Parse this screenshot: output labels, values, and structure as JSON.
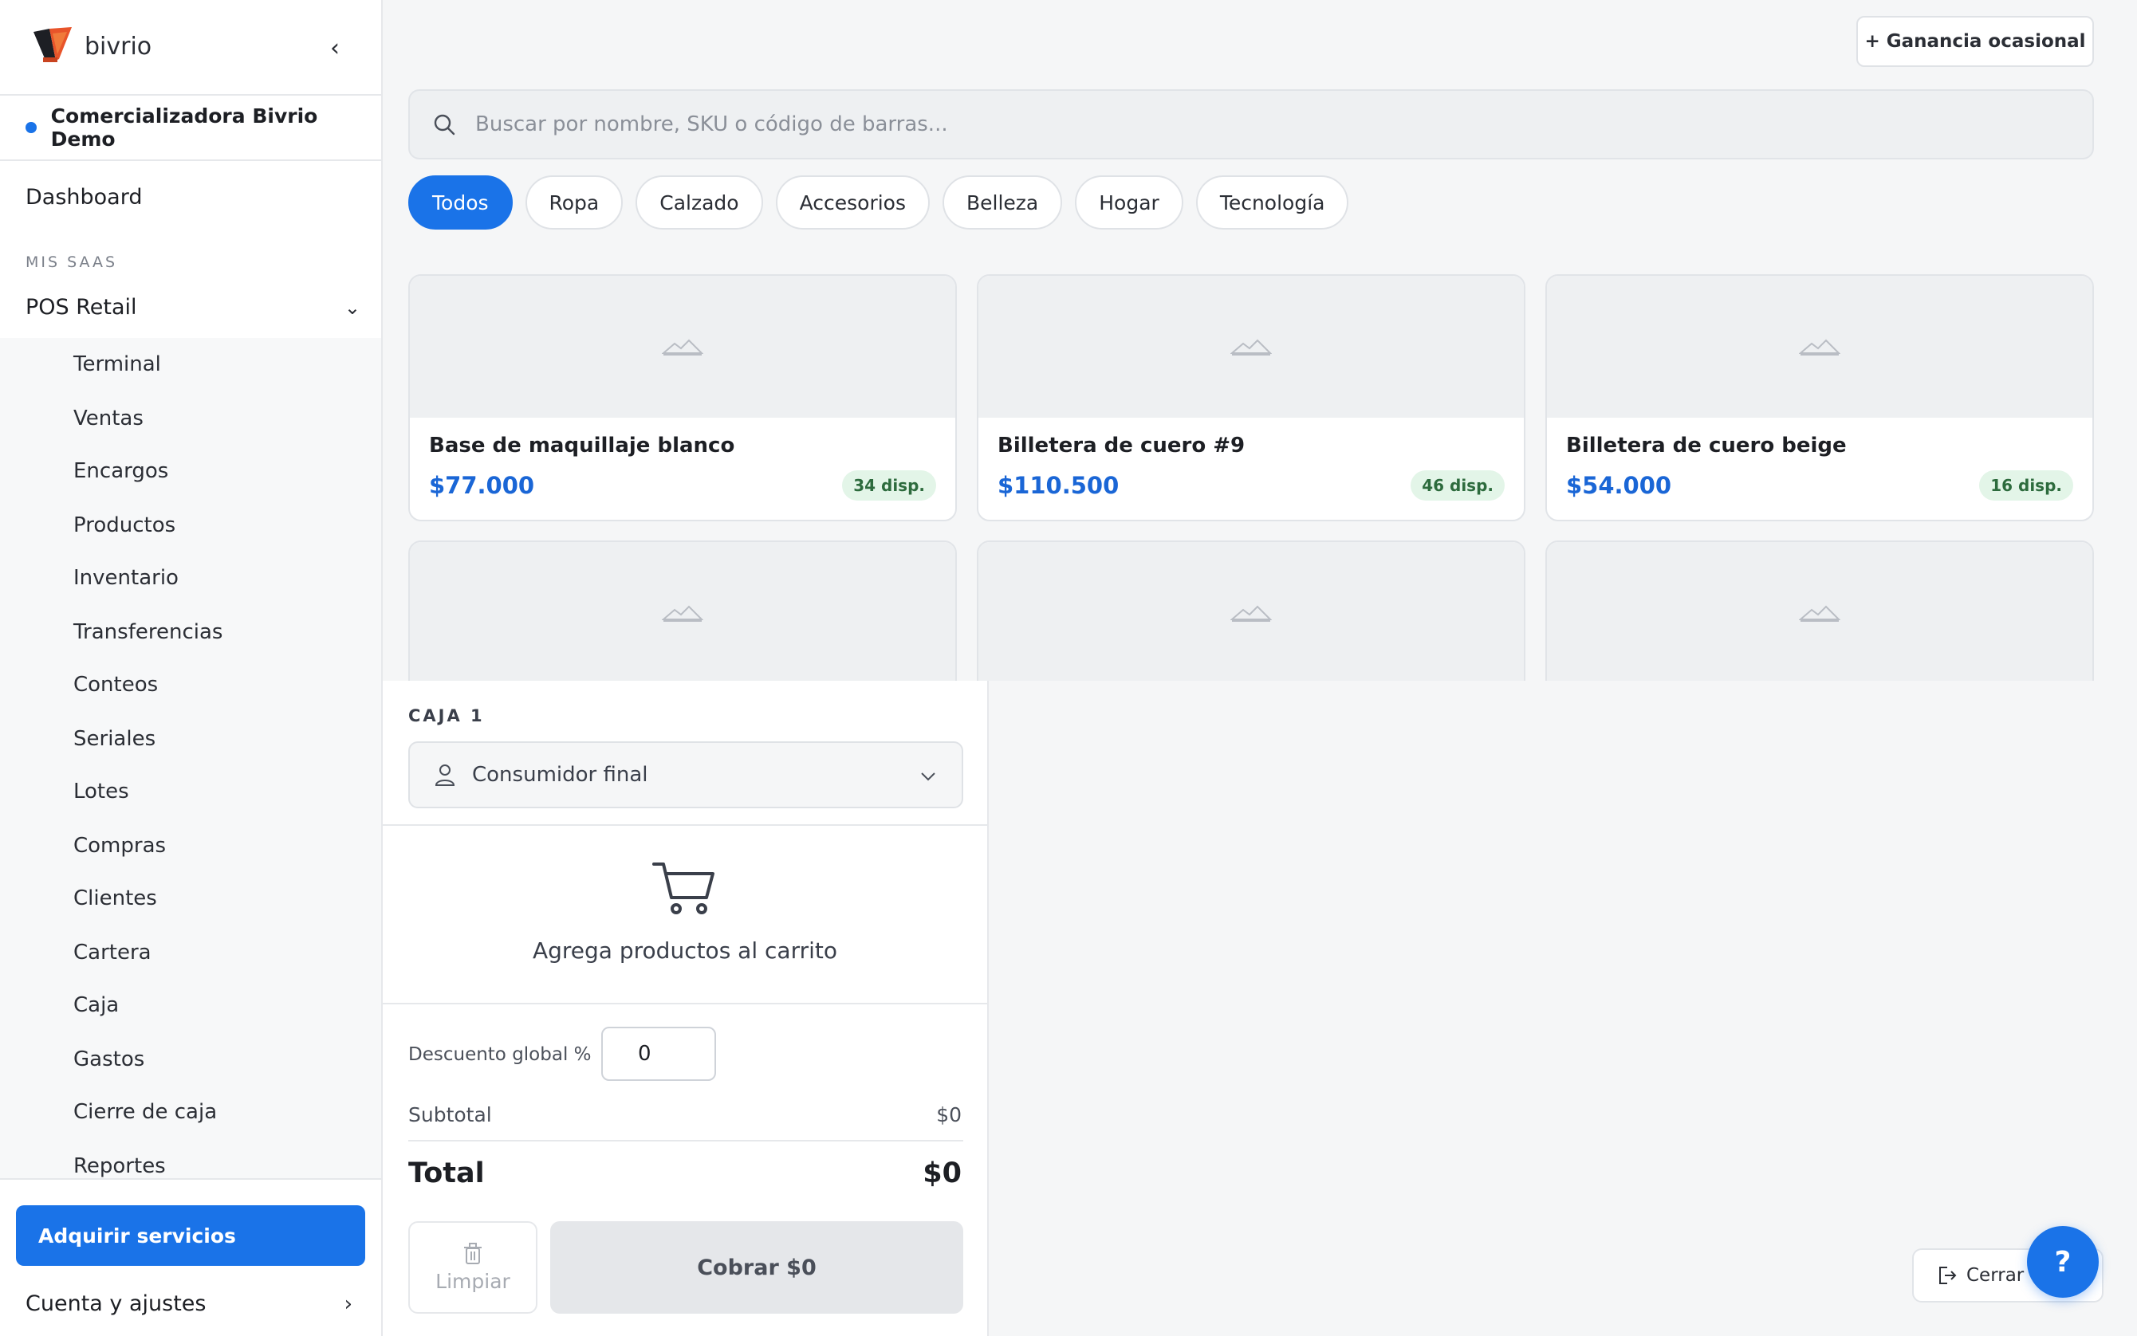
{
  "sidebar": {
    "brand": "bivrio",
    "organization": "Comercializadora Bivrio Demo",
    "dashboard": "Dashboard",
    "section_label": "MIS SAAS",
    "pos_label": "POS Retail",
    "pos_items": [
      "Terminal",
      "Ventas",
      "Encargos",
      "Productos",
      "Inventario",
      "Transferencias",
      "Conteos",
      "Seriales",
      "Lotes",
      "Compras",
      "Clientes",
      "Cartera",
      "Caja",
      "Gastos",
      "Cierre de caja",
      "Reportes"
    ],
    "acquire_label": "Adquirir servicios",
    "account_label": "Cuenta y ajustes"
  },
  "header": {
    "occasional_label": "+ Ganancia ocasional"
  },
  "search": {
    "placeholder": "Buscar por nombre, SKU o código de barras..."
  },
  "categories": [
    {
      "label": "Todos",
      "active": true
    },
    {
      "label": "Ropa",
      "active": false
    },
    {
      "label": "Calzado",
      "active": false
    },
    {
      "label": "Accesorios",
      "active": false
    },
    {
      "label": "Belleza",
      "active": false
    },
    {
      "label": "Hogar",
      "active": false
    },
    {
      "label": "Tecnología",
      "active": false
    }
  ],
  "products": [
    {
      "name": "Base de maquillaje blanco",
      "price": "$77.000",
      "stock": "34 disp."
    },
    {
      "name": "Billetera de cuero #9",
      "price": "$110.500",
      "stock": "46 disp."
    },
    {
      "name": "Billetera de cuero beige",
      "price": "$54.000",
      "stock": "16 disp."
    }
  ],
  "cart": {
    "register": "CAJA 1",
    "customer": "Consumidor final",
    "empty_message": "Agrega productos al carrito",
    "discount_label": "Descuento global %",
    "discount_value": "0",
    "subtotal_label": "Subtotal",
    "subtotal_value": "$0",
    "total_label": "Total",
    "total_value": "$0",
    "clear_label": "Limpiar",
    "charge_label": "Cobrar $0"
  },
  "footer": {
    "close_label": "Cerrar",
    "help_label": "?"
  },
  "colors": {
    "accent": "#1a73e8",
    "price": "#1a66d6",
    "stock_bg": "#e3f5e8",
    "stock_text": "#2d6b3d"
  }
}
